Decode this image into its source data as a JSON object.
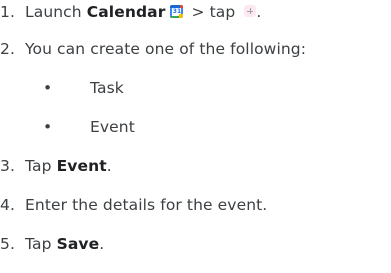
{
  "steps": [
    {
      "number": "1.",
      "prefix": "Launch ",
      "app": "Calendar",
      "icon": "calendar-app-icon",
      "middle": " > tap ",
      "icon2": "plus-icon",
      "suffix": "."
    },
    {
      "number": "2.",
      "text": "You can create one of the following:",
      "bullets": [
        {
          "symbol": "•",
          "text": "Task"
        },
        {
          "symbol": "•",
          "text": "Event"
        }
      ]
    },
    {
      "number": "3.",
      "prefix": "Tap ",
      "bold": "Event",
      "suffix": "."
    },
    {
      "number": "4.",
      "text": "Enter the details for the event."
    },
    {
      "number": "5.",
      "prefix": "Tap ",
      "bold": "Save",
      "suffix": "."
    }
  ],
  "colors": {
    "text": "#3c4043",
    "bold_text": "#202124",
    "calendar_blue": "#4285f4",
    "plus_bg": "#fce8f0"
  }
}
